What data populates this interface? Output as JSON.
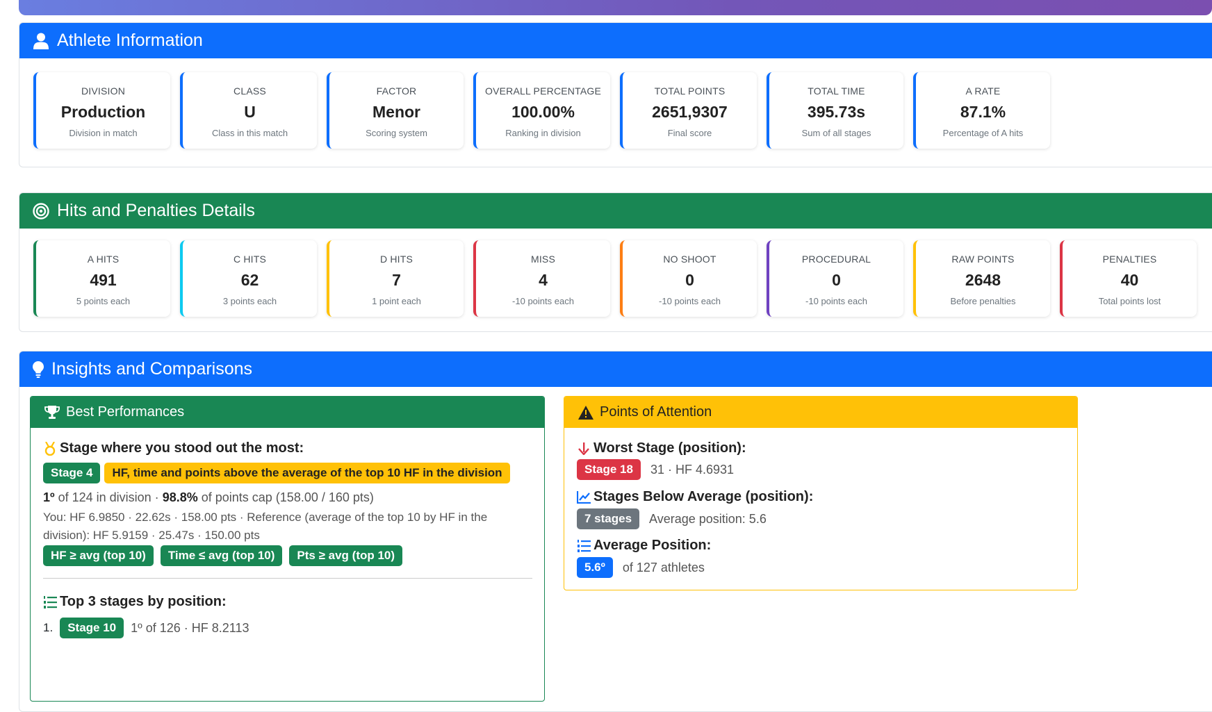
{
  "athlete": {
    "title": "Athlete Information",
    "cards": [
      {
        "label": "DIVISION",
        "value": "Production",
        "sub": "Division in match",
        "color": "#0d6efd"
      },
      {
        "label": "CLASS",
        "value": "U",
        "sub": "Class in this match",
        "color": "#0d6efd"
      },
      {
        "label": "FACTOR",
        "value": "Menor",
        "sub": "Scoring system",
        "color": "#0d6efd"
      },
      {
        "label": "OVERALL PERCENTAGE",
        "value": "100.00%",
        "sub": "Ranking in division",
        "color": "#0d6efd"
      },
      {
        "label": "TOTAL POINTS",
        "value": "2651,9307",
        "sub": "Final score",
        "color": "#0d6efd"
      },
      {
        "label": "TOTAL TIME",
        "value": "395.73s",
        "sub": "Sum of all stages",
        "color": "#0d6efd"
      },
      {
        "label": "A RATE",
        "value": "87.1%",
        "sub": "Percentage of A hits",
        "color": "#0d6efd"
      }
    ]
  },
  "hits": {
    "title": "Hits and Penalties Details",
    "cards": [
      {
        "label": "A HITS",
        "value": "491",
        "sub": "5 points each",
        "color": "#198754"
      },
      {
        "label": "C HITS",
        "value": "62",
        "sub": "3 points each",
        "color": "#0dcaf0"
      },
      {
        "label": "D HITS",
        "value": "7",
        "sub": "1 point each",
        "color": "#ffc107"
      },
      {
        "label": "MISS",
        "value": "4",
        "sub": "-10 points each",
        "color": "#dc3545"
      },
      {
        "label": "NO SHOOT",
        "value": "0",
        "sub": "-10 points each",
        "color": "#fd7e14"
      },
      {
        "label": "PROCEDURAL",
        "value": "0",
        "sub": "-10 points each",
        "color": "#6f42c1"
      },
      {
        "label": "RAW POINTS",
        "value": "2648",
        "sub": "Before penalties",
        "color": "#ffc107"
      },
      {
        "label": "PENALTIES",
        "value": "40",
        "sub": "Total points lost",
        "color": "#dc3545"
      }
    ]
  },
  "insights": {
    "title": "Insights and Comparisons",
    "best": {
      "title": "Best Performances",
      "standout_title": "Stage where you stood out the most:",
      "stage_badge": "Stage 4",
      "highlight_badge": "HF, time and points above the average of the top 10 HF in the division",
      "position_strong": "1º",
      "position_text": " of 124 in division · ",
      "cap_strong": "98.8%",
      "cap_text": " of points cap (158.00 / 160 pts)",
      "you_text": "You: HF 6.9850 · 22.62s · 158.00 pts · Reference (average of the top 10 by HF in the division): HF 5.9159 · 25.47s · 150.00 pts",
      "compare_badges": [
        "HF ≥ avg (top 10)",
        "Time ≤ avg (top 10)",
        "Pts ≥ avg (top 10)"
      ],
      "top3_title": "Top 3 stages by position:",
      "top3_first_num": "1.",
      "top3_first_badge": "Stage 10",
      "top3_first_text": "1º of 126 · HF 8.2113"
    },
    "attention": {
      "title": "Points of Attention",
      "worst_title": "Worst Stage (position):",
      "worst_badge": "Stage 18",
      "worst_text": "31 · HF 4.6931",
      "below_title": "Stages Below Average (position):",
      "below_badge": "7 stages",
      "below_text": "Average position: 5.6",
      "avg_title": "Average Position:",
      "avg_badge": "5.6º",
      "avg_text": "of 127 athletes"
    }
  }
}
